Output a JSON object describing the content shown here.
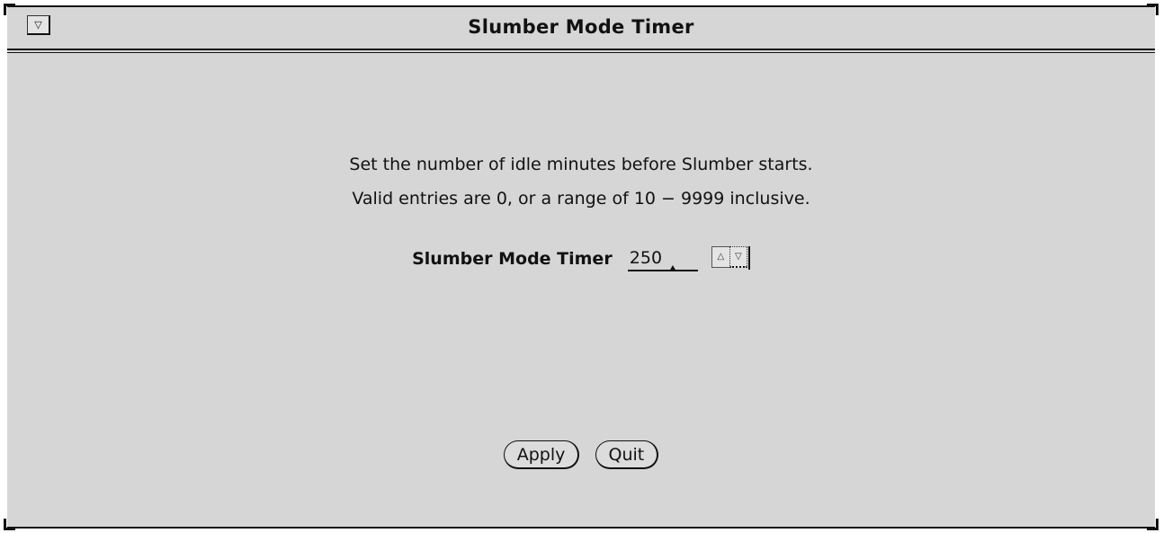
{
  "window": {
    "title": "Slumber Mode Timer",
    "menu_glyph": "▽"
  },
  "instructions": {
    "line1": "Set the number of idle minutes before Slumber starts.",
    "line2": "Valid entries are 0, or a range of 10 − 9999 inclusive."
  },
  "timer": {
    "label": "Slumber Mode Timer",
    "value": "250",
    "increment_glyph": "△",
    "decrement_glyph": "▽"
  },
  "buttons": {
    "apply_label": "Apply",
    "quit_label": "Quit"
  }
}
